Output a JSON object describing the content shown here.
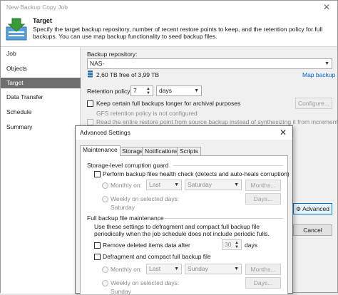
{
  "window": {
    "title": "New Backup Copy Job",
    "close": "✕"
  },
  "header": {
    "title": "Target",
    "description": "Specify the target backup repository, number of recent restore points to keep, and the retention policy for full backups. You can use map backup functionality to seed backup files."
  },
  "nav": {
    "items": [
      "Job",
      "Objects",
      "Target",
      "Data Transfer",
      "Schedule",
      "Summary"
    ],
    "selected_index": 2
  },
  "main": {
    "repo_label": "Backup repository:",
    "repo_value": "NAS-",
    "repo_free": "2,60 TB free of 3,99 TB",
    "map_backup": "Map backup",
    "retention_label": "Retention policy:",
    "retention_value": "7",
    "retention_unit": "days",
    "keep_full_label": "Keep certain full backups longer for archival purposes",
    "configure_label": "Configure...",
    "gfs_status": "GFS retention policy is not configured",
    "read_entire_label": "Read the entire restore point from source backup instead of synthesizing it from increments",
    "advanced_label": "Advanced",
    "cancel_label": "Cancel"
  },
  "dialog": {
    "title": "Advanced Settings",
    "close": "✕",
    "tabs": [
      "Maintenance",
      "Storage",
      "Notifications",
      "Scripts"
    ],
    "selected_tab": 0,
    "guard_header": "Storage-level corruption guard",
    "health_check_label": "Perform backup files health check (detects and auto-heals corruption)",
    "monthly_on_label": "Monthly on:",
    "monthly_week": "Last",
    "monthly_day": "Saturday",
    "months_button": "Months...",
    "weekly_label": "Weekly on selected days:",
    "weekly_days": "Saturday",
    "days_button": "Days...",
    "full_header": "Full backup file maintenance",
    "full_desc": "Use these settings to defragment and compact full backup file periodically when the job schedule does not include periodic fulls.",
    "remove_deleted_label": "Remove deleted items data after",
    "remove_value": "30",
    "remove_unit": "days",
    "defrag_label": "Defragment and compact full backup file",
    "monthly2_week": "Last",
    "monthly2_day": "Sunday",
    "weekly2_days": "Sunday"
  },
  "colors": {
    "accent": "#0078d7",
    "nav_selected": "#6e6e6e",
    "link": "#0066cc",
    "logo_green": "#3a9a3a"
  }
}
